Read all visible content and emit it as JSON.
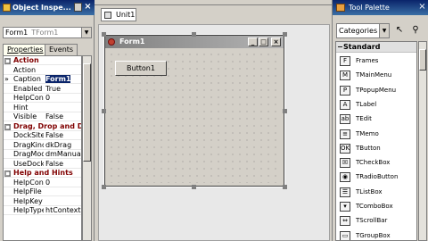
{
  "object_inspector": {
    "title": "Object Inspe...",
    "pin_icon": "pin-icon",
    "close_icon": "close-icon",
    "selected_component": "Form1",
    "selected_type": "TForm1",
    "tabs": [
      "Properties",
      "Events"
    ],
    "rows": [
      {
        "kind": "category",
        "name": "Action",
        "expander": "□"
      },
      {
        "kind": "prop",
        "name": "Action",
        "value": ""
      },
      {
        "kind": "prop",
        "name": "Caption",
        "value": "Form1",
        "selected": true
      },
      {
        "kind": "prop",
        "name": "Enabled",
        "value": "True"
      },
      {
        "kind": "prop",
        "name": "HelpCont",
        "value": "0"
      },
      {
        "kind": "prop",
        "name": "Hint",
        "value": ""
      },
      {
        "kind": "prop",
        "name": "Visible",
        "value": "False"
      },
      {
        "kind": "category",
        "name": "Drag, Drop and Do",
        "expander": "□"
      },
      {
        "kind": "prop",
        "name": "DockSite",
        "value": "False"
      },
      {
        "kind": "prop",
        "name": "DragKind",
        "value": "dkDrag"
      },
      {
        "kind": "prop",
        "name": "DragMode",
        "value": "dmManual"
      },
      {
        "kind": "prop",
        "name": "UseDock",
        "value": "False"
      },
      {
        "kind": "category",
        "name": "Help and Hints",
        "expander": "□"
      },
      {
        "kind": "prop",
        "name": "HelpCont",
        "value": "0"
      },
      {
        "kind": "prop",
        "name": "HelpFile",
        "value": ""
      },
      {
        "kind": "prop",
        "name": "HelpKey",
        "value": ""
      },
      {
        "kind": "prop",
        "name": "HelpType",
        "value": "htContext"
      }
    ],
    "row_marker": "»"
  },
  "editor": {
    "tab_label": "Unit1"
  },
  "form": {
    "caption": "Form1",
    "minimize_glyph": "_",
    "maximize_glyph": "□",
    "close_glyph": "×",
    "button_caption": "Button1"
  },
  "tool_palette": {
    "title": "Tool Palette",
    "category": "Categories",
    "group": "Standard",
    "items": [
      {
        "label": "Frames",
        "glyph": "F"
      },
      {
        "label": "TMainMenu",
        "glyph": "M"
      },
      {
        "label": "TPopupMenu",
        "glyph": "P"
      },
      {
        "label": "TLabel",
        "glyph": "A"
      },
      {
        "label": "TEdit",
        "glyph": "ab"
      },
      {
        "label": "TMemo",
        "glyph": "≡"
      },
      {
        "label": "TButton",
        "glyph": "OK"
      },
      {
        "label": "TCheckBox",
        "glyph": "☒"
      },
      {
        "label": "TRadioButton",
        "glyph": "◉"
      },
      {
        "label": "TListBox",
        "glyph": "☰"
      },
      {
        "label": "TComboBox",
        "glyph": "▾"
      },
      {
        "label": "TScrollBar",
        "glyph": "⇔"
      },
      {
        "label": "TGroupBox",
        "glyph": "▭"
      }
    ]
  }
}
